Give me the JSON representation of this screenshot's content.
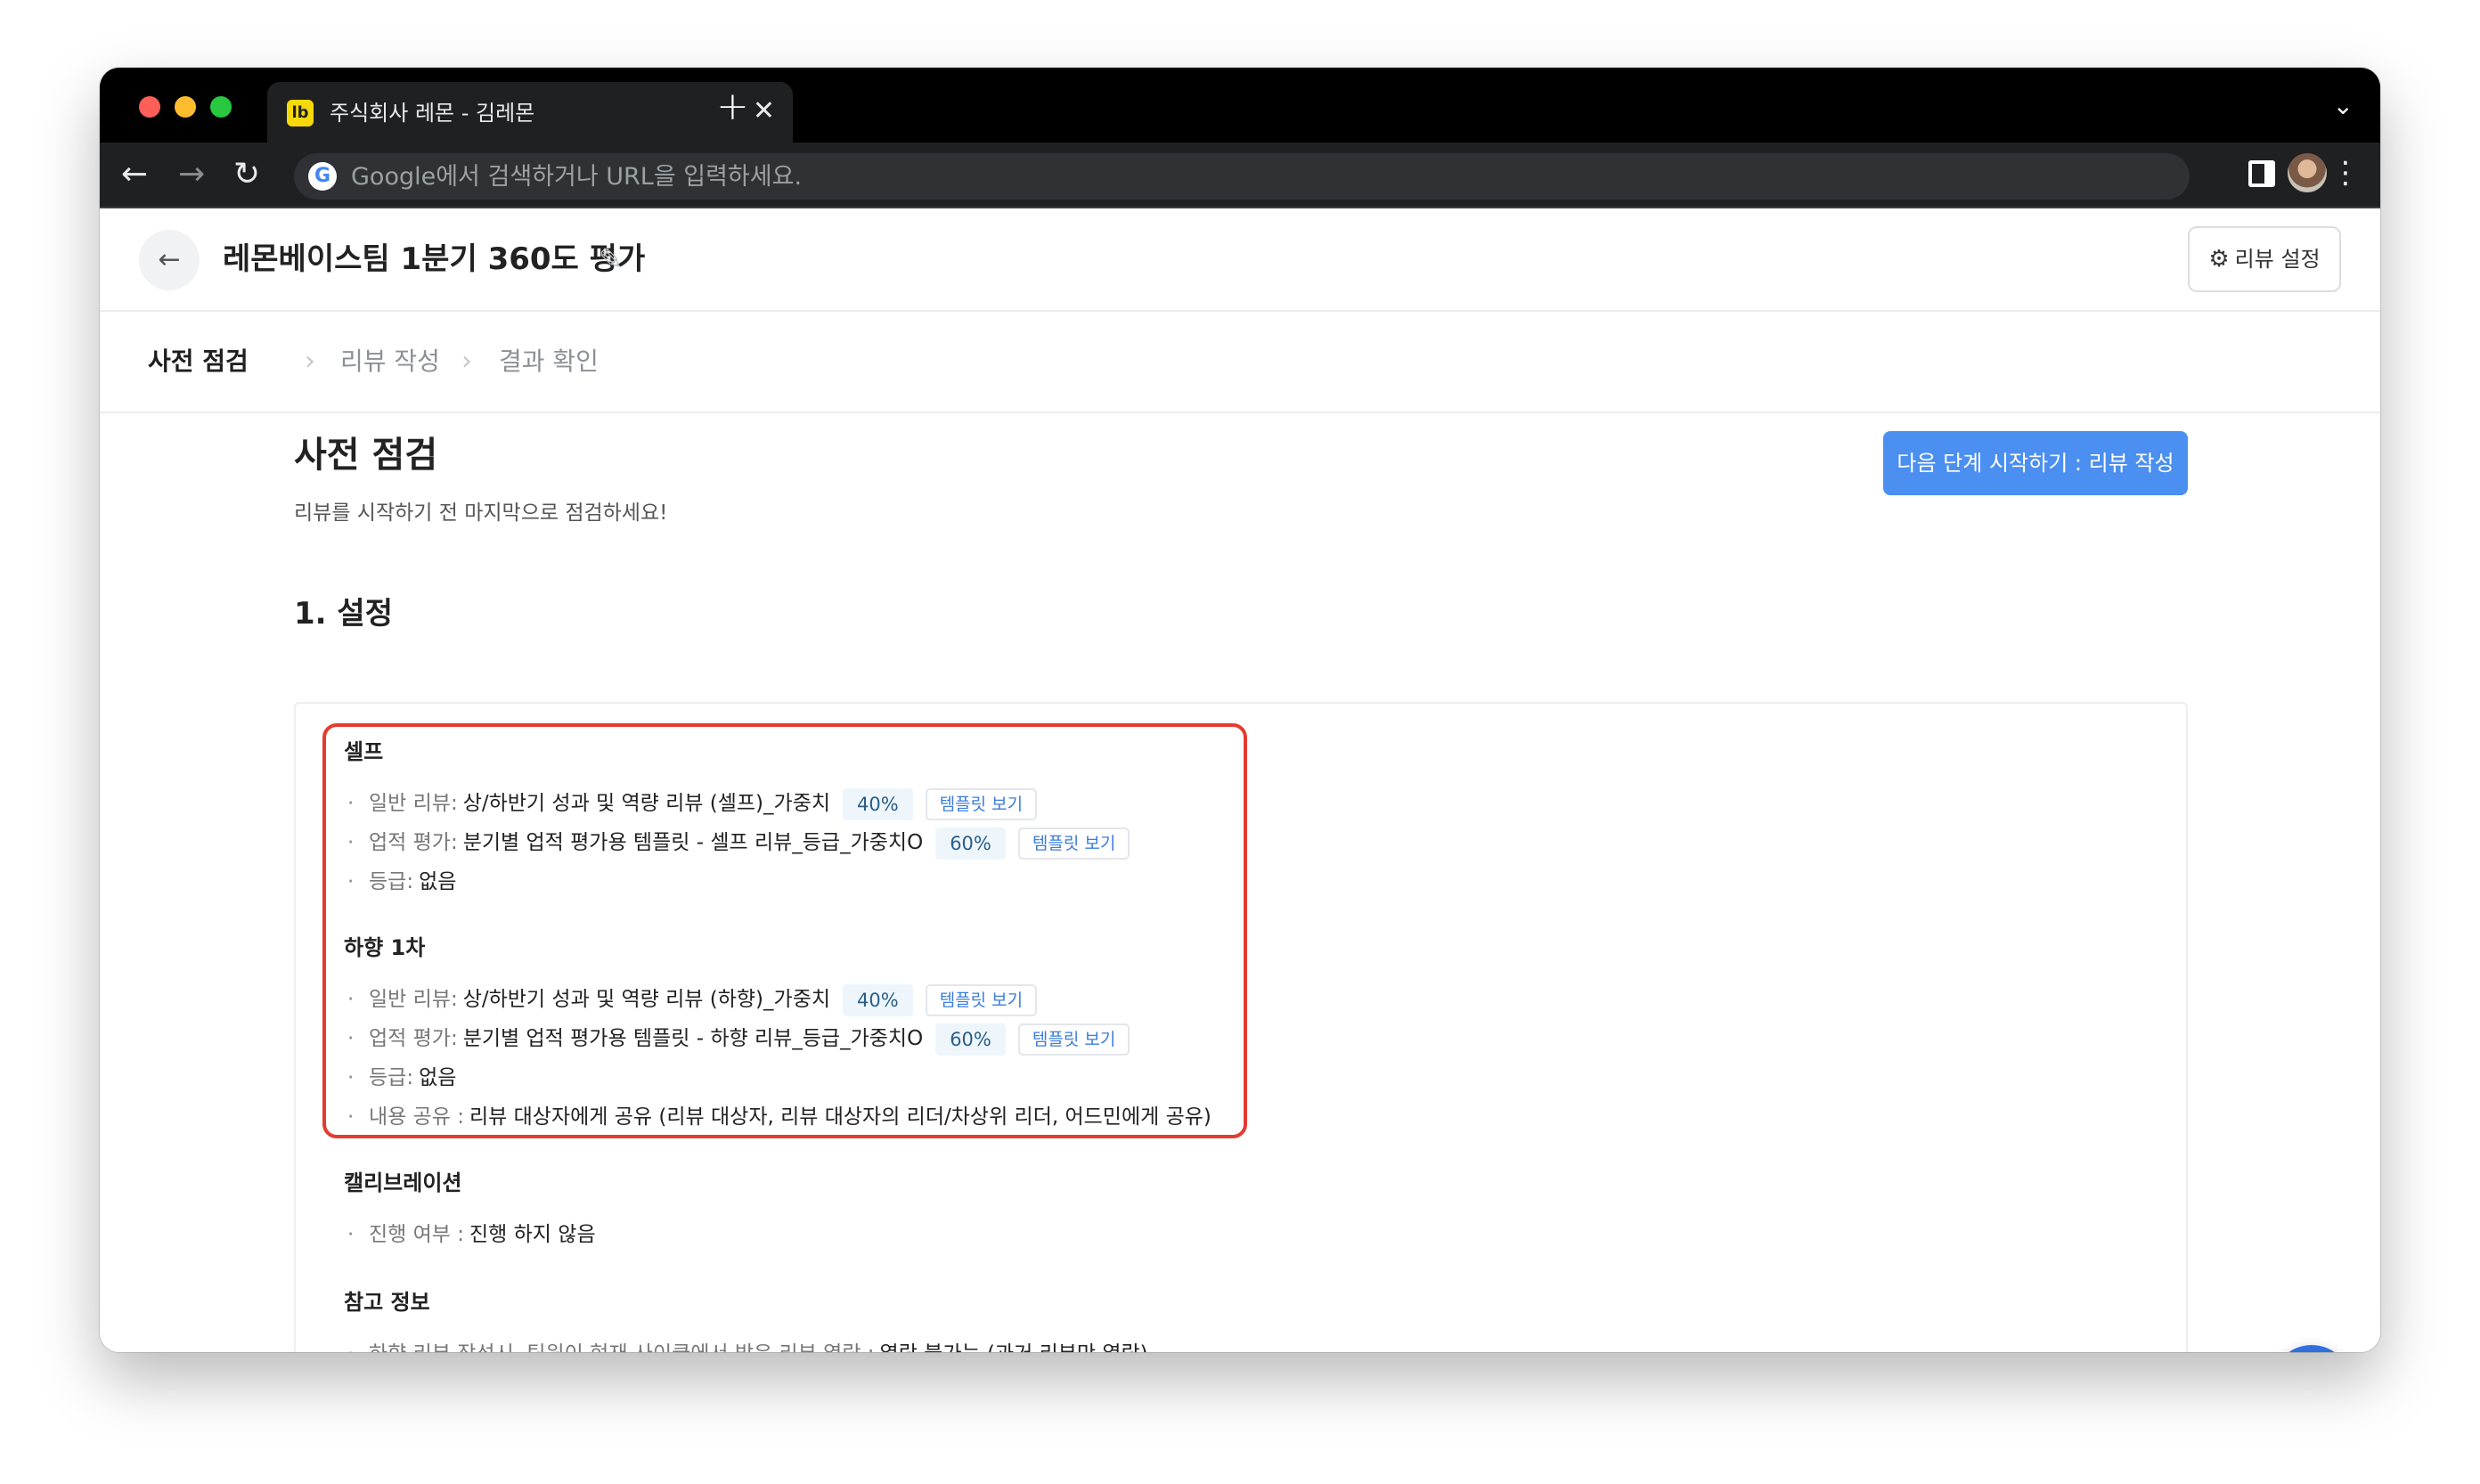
{
  "browser": {
    "tab_favicon": "lb",
    "tab_title": "주식회사 레몬 - 김레몬",
    "close_glyph": "✕",
    "newtab_glyph": "+",
    "address_placeholder": "Google에서 검색하거나 URL을 입력하세요.",
    "google_glyph": "G"
  },
  "header": {
    "title": "레몬베이스팀 1분기 360도 평가",
    "settings_label": "리뷰 설정"
  },
  "steps": [
    {
      "label": "사전 점검",
      "active": true
    },
    {
      "label": "리뷰 작성",
      "active": false
    },
    {
      "label": "결과 확인",
      "active": false
    }
  ],
  "main": {
    "title": "사전 점검",
    "subtitle": "리뷰를 시작하기 전 마지막으로 점검하세요!",
    "next_button": "다음 단계 시작하기 : 리뷰 작성",
    "section_heading": "1. 설정"
  },
  "settings": {
    "self": {
      "title": "셀프",
      "rows": [
        {
          "label": "일반 리뷰:",
          "value": "상/하반기 성과 및 역량 리뷰 (셀프)_가중치",
          "pct": "40%",
          "template": "템플릿 보기"
        },
        {
          "label": "업적 평가:",
          "value": "분기별 업적 평가용 템플릿 - 셀프 리뷰_등급_가중치O",
          "pct": "60%",
          "template": "템플릿 보기"
        },
        {
          "label": "등급:",
          "value": "없음"
        }
      ]
    },
    "down1": {
      "title": "하향 1차",
      "rows": [
        {
          "label": "일반 리뷰:",
          "value": "상/하반기 성과 및 역량 리뷰 (하향)_가중치",
          "pct": "40%",
          "template": "템플릿 보기"
        },
        {
          "label": "업적 평가:",
          "value": "분기별 업적 평가용 템플릿 - 하향 리뷰_등급_가중치O",
          "pct": "60%",
          "template": "템플릿 보기"
        },
        {
          "label": "등급:",
          "value": "없음"
        },
        {
          "label": "내용 공유 :",
          "value": "리뷰 대상자에게 공유 (리뷰 대상자, 리뷰 대상자의 리더/차상위 리더, 어드민에게 공유)"
        }
      ]
    },
    "calibration": {
      "title": "캘리브레이션",
      "rows": [
        {
          "label": "진행 여부 :",
          "value": "진행 하지 않음"
        }
      ]
    },
    "reference": {
      "title": "참고 정보",
      "rows": [
        {
          "label": "하향 리뷰 작성시, 팀원이 현재 사이클에서 받은 리뷰 열람 :",
          "value": "열람 불가능 (과거 리뷰만 열람)"
        }
      ]
    }
  },
  "colors": {
    "highlight_border": "#e53b2f",
    "primary": "#4b8ff0",
    "help_button": "#2f6fe0"
  }
}
